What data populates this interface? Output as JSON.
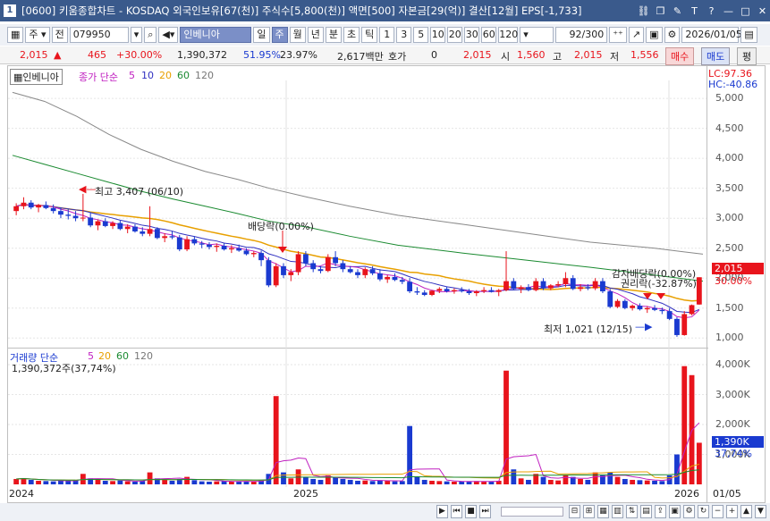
{
  "window": {
    "number": "1",
    "title": "[0600] 키움종합차트 - KOSDAQ 외국인보유[67(천)] 주식수[5,800(천)] 액면[500] 자본금[29(억)] 결산[12월] EPS[-1,733]"
  },
  "toolbar": {
    "type_select": "주",
    "prev": "전",
    "code": "079950",
    "name": "인베니아",
    "periods": [
      "일",
      "주",
      "월",
      "년",
      "분",
      "초",
      "틱"
    ],
    "selected_period": "주",
    "intervals": [
      "1",
      "3",
      "5",
      "10",
      "20",
      "30",
      "60",
      "120"
    ],
    "count": "92",
    "total": "/300",
    "date": "2026/01/05"
  },
  "pricebar": {
    "price": "2,015",
    "change": "465",
    "change_pct": "+30.00%",
    "volume": "1,390,372",
    "ratio1": "51.95%",
    "ratio2": "23.97%",
    "amount": "2,617백만",
    "hoga_label": "호가",
    "hoga_val": "0",
    "hoga_price": "2,015",
    "open_label": "시",
    "open": "1,560",
    "high_label": "고",
    "high": "2,015",
    "low_label": "저",
    "low": "1,556",
    "buy": "매수",
    "sell": "매도",
    "avg": "평"
  },
  "price_panel": {
    "stock_label": "인베니아",
    "ma_label": "종가 단순",
    "ma_periods": [
      "5",
      "10",
      "20",
      "60",
      "120"
    ],
    "ma_colors": [
      "#c020c0",
      "#3030c0",
      "#e8a000",
      "#1a8a30",
      "#777777"
    ],
    "lc": "LC:97.36",
    "hc": "HC:-40.86",
    "annotations": {
      "high": "최고 3,407 (06/10)",
      "dividend": "배당락(0.00%)",
      "low": "최저 1,021 (12/15)",
      "reduction": "감자배당락(0.00%)",
      "rights": "권리락(-32.87%)"
    },
    "current_price": "2,015",
    "current_pct": "30.00%",
    "y_ticks": [
      "5,000",
      "4,500",
      "4,000",
      "3,500",
      "3,000",
      "2,500",
      "2,000",
      "1,500",
      "1,000"
    ]
  },
  "volume_panel": {
    "label": "거래량 단순",
    "ma_periods": [
      "5",
      "20",
      "60",
      "120"
    ],
    "current": "1,390,372주(37,74%)",
    "current_axis": "1,390K",
    "current_pct": "37,74%",
    "y_ticks": [
      "4,000K",
      "3,000K",
      "2,000K",
      "1,000K"
    ]
  },
  "x_labels": [
    "2024",
    "2025",
    "2026",
    "01/05"
  ],
  "chart_data": {
    "type": "candlestick",
    "ylim": [
      900,
      5300
    ],
    "vol_ylim": [
      0,
      4300000
    ],
    "candles": [
      [
        3120,
        3250,
        3050,
        3200,
        180000
      ],
      [
        3200,
        3350,
        3150,
        3260,
        210000
      ],
      [
        3260,
        3300,
        3150,
        3180,
        150000
      ],
      [
        3180,
        3240,
        3100,
        3220,
        120000
      ],
      [
        3220,
        3280,
        3150,
        3170,
        110000
      ],
      [
        3170,
        3230,
        3080,
        3120,
        100000
      ],
      [
        3120,
        3180,
        3000,
        3060,
        140000
      ],
      [
        3060,
        3150,
        2980,
        3040,
        130000
      ],
      [
        3040,
        3120,
        2950,
        3000,
        120000
      ],
      [
        3000,
        3407,
        2950,
        3010,
        350000
      ],
      [
        3010,
        3100,
        2850,
        2880,
        200000
      ],
      [
        2880,
        2980,
        2800,
        2950,
        150000
      ],
      [
        2950,
        3000,
        2850,
        2870,
        120000
      ],
      [
        2870,
        2950,
        2820,
        2920,
        110000
      ],
      [
        2920,
        2960,
        2800,
        2820,
        130000
      ],
      [
        2820,
        2900,
        2750,
        2860,
        100000
      ],
      [
        2860,
        2900,
        2760,
        2780,
        90000
      ],
      [
        2780,
        2850,
        2700,
        2740,
        110000
      ],
      [
        2740,
        3200,
        2700,
        2820,
        400000
      ],
      [
        2820,
        2850,
        2650,
        2670,
        200000
      ],
      [
        2670,
        2750,
        2600,
        2700,
        150000
      ],
      [
        2700,
        2780,
        2650,
        2680,
        120000
      ],
      [
        2680,
        2720,
        2450,
        2480,
        180000
      ],
      [
        2480,
        2700,
        2450,
        2650,
        250000
      ],
      [
        2650,
        2700,
        2550,
        2580,
        140000
      ],
      [
        2580,
        2620,
        2500,
        2560,
        100000
      ],
      [
        2560,
        2600,
        2480,
        2520,
        90000
      ],
      [
        2520,
        2580,
        2440,
        2540,
        100000
      ],
      [
        2540,
        2580,
        2460,
        2480,
        110000
      ],
      [
        2480,
        2550,
        2420,
        2500,
        95000
      ],
      [
        2500,
        2560,
        2440,
        2460,
        90000
      ],
      [
        2460,
        2500,
        2380,
        2400,
        100000
      ],
      [
        2400,
        2450,
        2350,
        2420,
        90000
      ],
      [
        2420,
        2460,
        2200,
        2300,
        150000
      ],
      [
        2300,
        2350,
        1850,
        1880,
        350000
      ],
      [
        1880,
        2250,
        1850,
        2200,
        2950000
      ],
      [
        2200,
        2250,
        2000,
        2050,
        400000
      ],
      [
        2050,
        2150,
        1950,
        2100,
        200000
      ],
      [
        2100,
        2450,
        2050,
        2400,
        500000
      ],
      [
        2400,
        2450,
        2200,
        2250,
        250000
      ],
      [
        2250,
        2300,
        2100,
        2150,
        180000
      ],
      [
        2150,
        2200,
        2080,
        2120,
        150000
      ],
      [
        2120,
        2400,
        2100,
        2350,
        300000
      ],
      [
        2350,
        2450,
        2200,
        2250,
        250000
      ],
      [
        2250,
        2300,
        2100,
        2150,
        180000
      ],
      [
        2150,
        2200,
        2080,
        2100,
        150000
      ],
      [
        2100,
        2150,
        2000,
        2050,
        120000
      ],
      [
        2050,
        2180,
        2000,
        2150,
        130000
      ],
      [
        2150,
        2200,
        2050,
        2080,
        110000
      ],
      [
        2080,
        2150,
        1950,
        1980,
        140000
      ],
      [
        1980,
        2050,
        1920,
        2020,
        120000
      ],
      [
        2020,
        2080,
        1950,
        1970,
        100000
      ],
      [
        1970,
        2020,
        1900,
        1940,
        110000
      ],
      [
        1940,
        2000,
        1750,
        1780,
        1950000
      ],
      [
        1780,
        1850,
        1720,
        1760,
        250000
      ],
      [
        1760,
        1800,
        1700,
        1720,
        150000
      ],
      [
        1720,
        1800,
        1700,
        1790,
        120000
      ],
      [
        1790,
        1850,
        1750,
        1820,
        110000
      ],
      [
        1820,
        1860,
        1760,
        1780,
        100000
      ],
      [
        1780,
        1830,
        1740,
        1800,
        90000
      ],
      [
        1800,
        1850,
        1760,
        1780,
        90000
      ],
      [
        1780,
        1820,
        1720,
        1750,
        100000
      ],
      [
        1750,
        1800,
        1700,
        1780,
        110000
      ],
      [
        1780,
        1850,
        1750,
        1800,
        100000
      ],
      [
        1800,
        1850,
        1760,
        1770,
        90000
      ],
      [
        1770,
        1820,
        1700,
        1800,
        120000
      ],
      [
        1800,
        2450,
        1780,
        1950,
        3800000
      ],
      [
        1950,
        2000,
        1800,
        1820,
        500000
      ],
      [
        1820,
        1880,
        1750,
        1850,
        200000
      ],
      [
        1850,
        1900,
        1780,
        1800,
        150000
      ],
      [
        1800,
        2000,
        1780,
        1950,
        350000
      ],
      [
        1950,
        2000,
        1800,
        1830,
        250000
      ],
      [
        1830,
        1900,
        1800,
        1880,
        150000
      ],
      [
        1880,
        1950,
        1850,
        1900,
        130000
      ],
      [
        1900,
        2100,
        1850,
        2000,
        300000
      ],
      [
        2000,
        2050,
        1800,
        1820,
        250000
      ],
      [
        1820,
        1900,
        1780,
        1850,
        180000
      ],
      [
        1850,
        1900,
        1800,
        1830,
        150000
      ],
      [
        1830,
        2000,
        1800,
        1950,
        400000
      ],
      [
        1950,
        2000,
        1750,
        1780,
        300000
      ],
      [
        1780,
        1820,
        1500,
        1520,
        400000
      ],
      [
        1520,
        1650,
        1500,
        1620,
        250000
      ],
      [
        1620,
        1650,
        1480,
        1500,
        180000
      ],
      [
        1500,
        1560,
        1460,
        1540,
        150000
      ],
      [
        1540,
        1580,
        1460,
        1480,
        140000
      ],
      [
        1480,
        1530,
        1420,
        1500,
        130000
      ],
      [
        1500,
        1550,
        1450,
        1470,
        120000
      ],
      [
        1470,
        1510,
        1400,
        1450,
        110000
      ],
      [
        1450,
        1500,
        1300,
        1320,
        300000
      ],
      [
        1320,
        1350,
        1021,
        1050,
        1000000
      ],
      [
        1050,
        1450,
        1040,
        1400,
        3950000
      ],
      [
        1400,
        1560,
        1380,
        1550,
        3650000
      ],
      [
        1560,
        2015,
        1556,
        2015,
        1390372
      ]
    ],
    "ma120": [
      [
        0,
        5100
      ],
      [
        10,
        4950
      ],
      [
        20,
        4700
      ],
      [
        30,
        4400
      ],
      [
        40,
        4150
      ],
      [
        50,
        3950
      ],
      [
        60,
        3780
      ],
      [
        70,
        3650
      ],
      [
        80,
        3500
      ],
      [
        92,
        3350
      ],
      [
        105,
        3200
      ],
      [
        120,
        3050
      ],
      [
        140,
        2900
      ],
      [
        160,
        2750
      ],
      [
        180,
        2600
      ],
      [
        200,
        2500
      ],
      [
        215,
        2400
      ]
    ],
    "ma60": [
      [
        0,
        4050
      ],
      [
        10,
        3900
      ],
      [
        20,
        3750
      ],
      [
        30,
        3600
      ],
      [
        40,
        3450
      ],
      [
        50,
        3320
      ],
      [
        60,
        3200
      ],
      [
        70,
        3080
      ],
      [
        80,
        2950
      ],
      [
        92,
        2850
      ],
      [
        105,
        2700
      ],
      [
        120,
        2550
      ],
      [
        140,
        2420
      ],
      [
        160,
        2300
      ],
      [
        180,
        2180
      ],
      [
        200,
        2050
      ],
      [
        215,
        1950
      ]
    ]
  }
}
